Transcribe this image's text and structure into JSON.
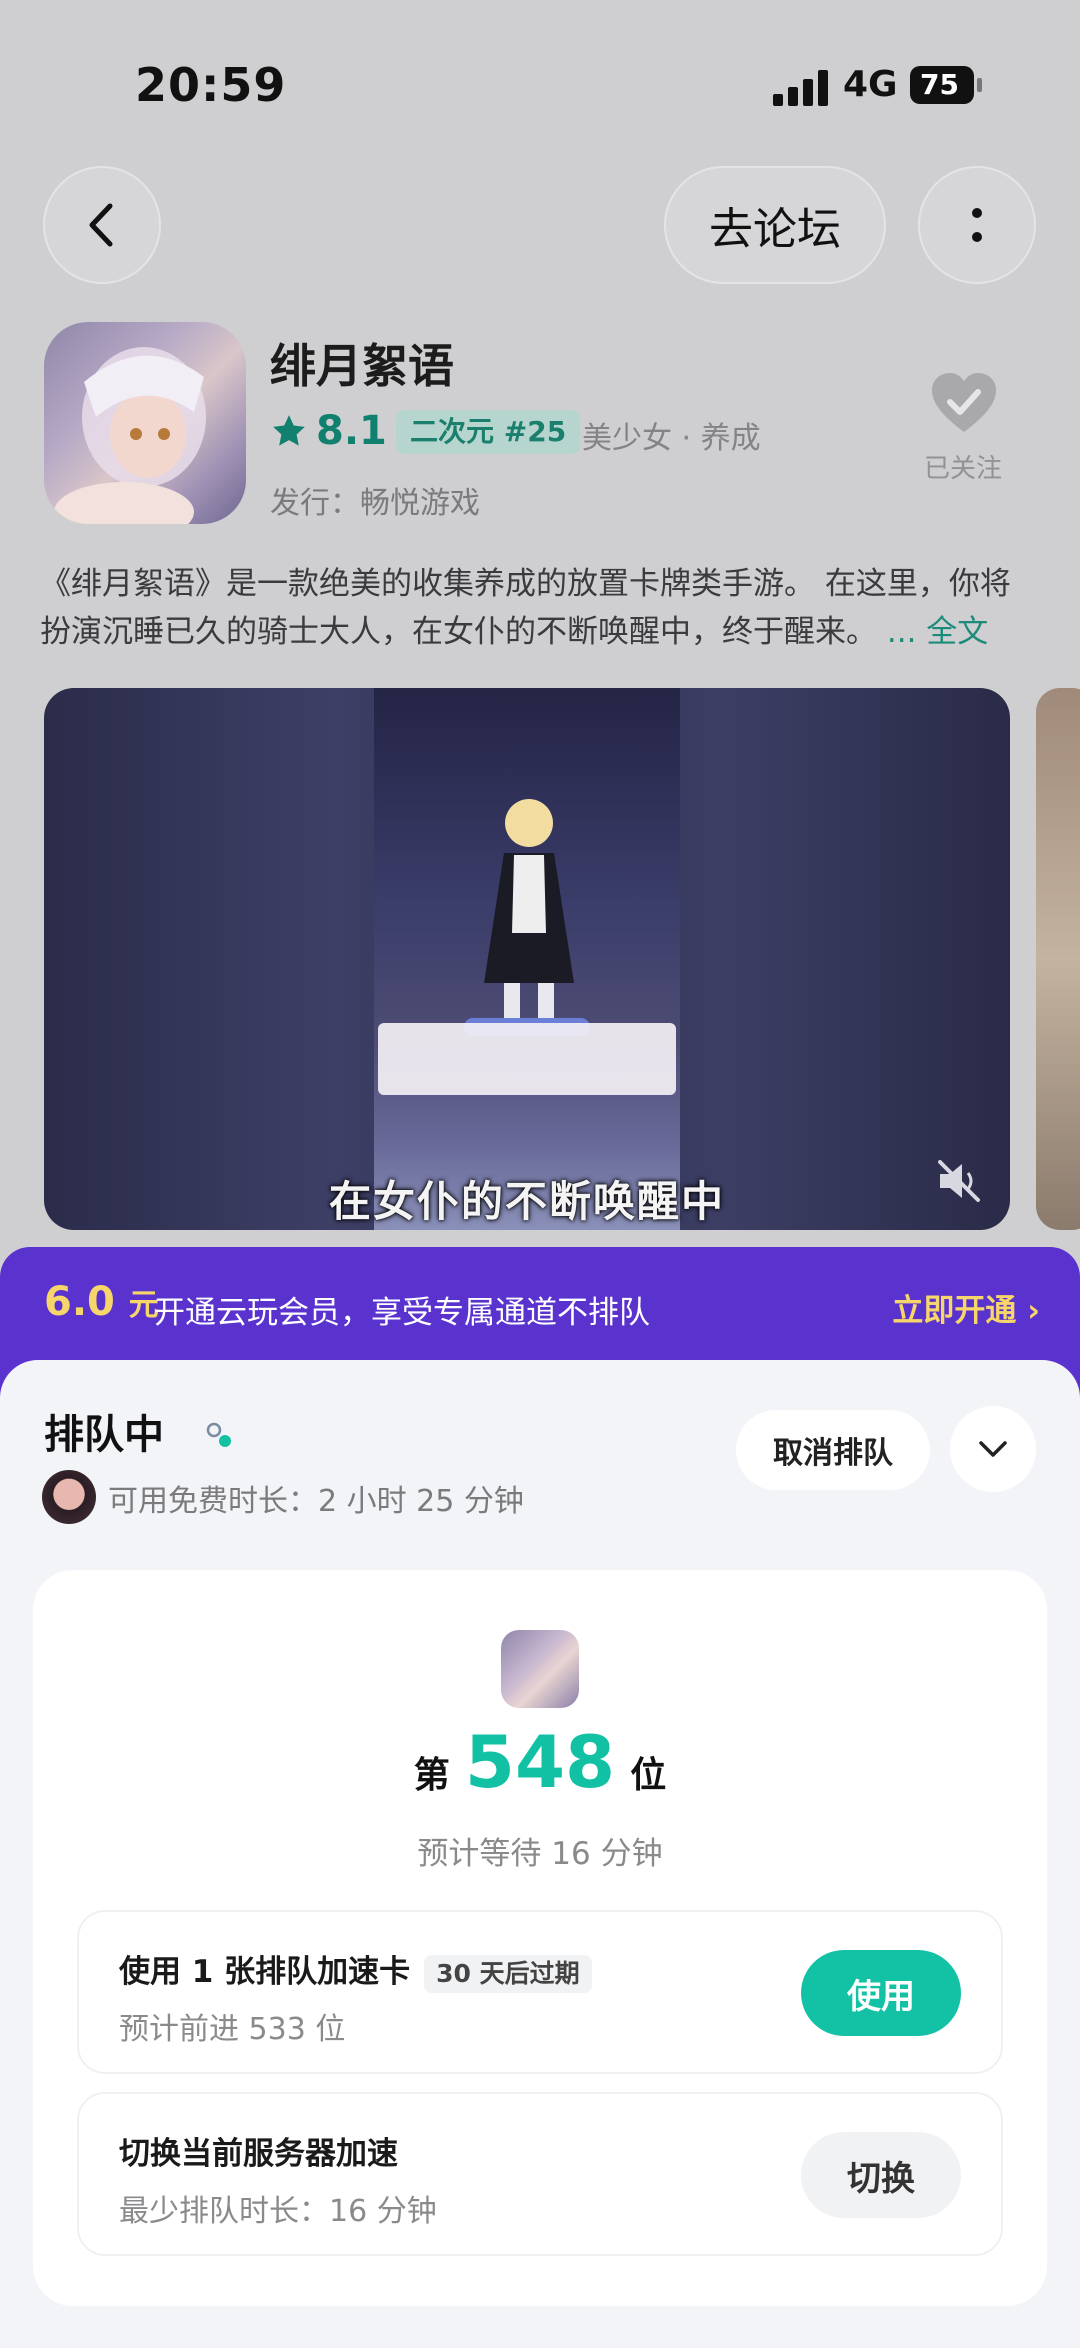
{
  "status_bar": {
    "time": "20:59",
    "network": "4G",
    "battery": "75"
  },
  "top_bar": {
    "forum_label": "去论坛"
  },
  "game": {
    "title": "绯月絮语",
    "rating": "8.1",
    "rank_chip": "二次元 #25",
    "tags": "美少女 · 养成",
    "publisher": "发行：畅悦游戏",
    "follow_label": "已关注",
    "description": "《绯月絮语》是一款绝美的收集养成的放置卡牌类手游。 在这里，你将扮演沉睡已久的骑士大人，在女仆的不断唤醒中，终于醒来。",
    "more_label": "... 全文"
  },
  "video": {
    "subtitle": "在女仆的不断唤醒中"
  },
  "member_banner": {
    "price": "6.0",
    "unit": "元",
    "text": "开通云玩会员，享受专属通道不排队",
    "cta": "立即开通 ›"
  },
  "queue": {
    "title": "排队中",
    "free_time": "可用免费时长：2 小时 25 分钟",
    "cancel_label": "取消排队",
    "position_prefix": "第",
    "position": "548",
    "position_suffix": "位",
    "wait_text": "预计等待 16 分钟",
    "options": [
      {
        "title": "使用 1 张排队加速卡",
        "chip": "30 天后过期",
        "sub": "预计前进 533 位",
        "button": "使用"
      },
      {
        "title": "切换当前服务器加速",
        "sub": "最少排队时长：16 分钟",
        "button": "切换"
      }
    ]
  },
  "colors": {
    "accent": "#13c2a5",
    "banner": "#5a33cf",
    "banner_highlight": "#f6d66a"
  }
}
